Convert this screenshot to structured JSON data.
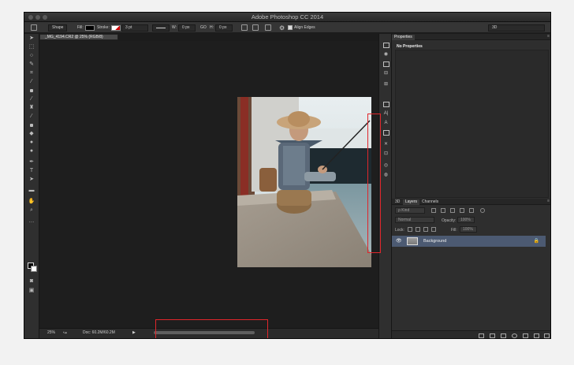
{
  "window": {
    "title": "Adobe Photoshop CC 2014"
  },
  "options_bar": {
    "tool_mode": "Shape",
    "fill_label": "Fill:",
    "stroke_label": "Stroke:",
    "stroke_width": "3 pt",
    "w_label": "W:",
    "w_value": "0 px",
    "go_icon": "GO",
    "h_label": "H:",
    "h_value": "0 px",
    "align_edges_label": "Align Edges",
    "workspace": "3D"
  },
  "document_tab": {
    "label": "_MG_4194.CR2 @ 25% (RGB/8)"
  },
  "status_bar": {
    "zoom": "25%",
    "doc_info": "Doc: 60.2M/60.2M"
  },
  "properties_panel": {
    "tab_label": "Properties",
    "content_label": "No Properties"
  },
  "layers_panel": {
    "tabs": [
      "3D",
      "Layers",
      "Channels"
    ],
    "kind_filter": "ρ Kind",
    "blend_mode": "Normal",
    "opacity_label": "Opacity:",
    "opacity_value": "100%",
    "lock_label": "Lock:",
    "fill_label": "Fill:",
    "fill_value": "100%",
    "layers": [
      {
        "name": "Background",
        "visible": true,
        "locked": true
      }
    ]
  },
  "side_icons": {
    "paragraph_icon": "A|",
    "text_icon": "A"
  },
  "colors": {
    "window_bg": "#1c1c1c",
    "panel_bg": "#2e2e2e",
    "selected_layer": "#4c5a72",
    "highlight_red": "#e0262b"
  }
}
